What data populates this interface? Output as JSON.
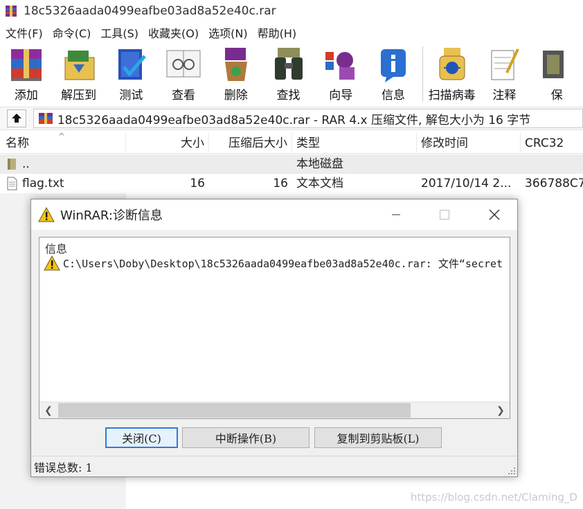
{
  "window": {
    "title": "18c5326aada0499eafbe03ad8a52e40c.rar"
  },
  "menu": [
    "文件(F)",
    "命令(C)",
    "工具(S)",
    "收藏夹(O)",
    "选项(N)",
    "帮助(H)"
  ],
  "toolbar": [
    {
      "label": "添加",
      "icon": "archive-books-icon"
    },
    {
      "label": "解压到",
      "icon": "extract-folder-icon"
    },
    {
      "label": "测试",
      "icon": "test-check-icon"
    },
    {
      "label": "查看",
      "icon": "view-glasses-icon"
    },
    {
      "label": "删除",
      "icon": "delete-recycle-icon"
    },
    {
      "label": "查找",
      "icon": "find-binoculars-icon"
    },
    {
      "label": "向导",
      "icon": "wizard-icon"
    },
    {
      "label": "信息",
      "icon": "info-icon"
    },
    {
      "label": "扫描病毒",
      "icon": "virus-scan-icon"
    },
    {
      "label": "注释",
      "icon": "comment-notepad-icon"
    },
    {
      "label": "保",
      "icon": "protect-icon"
    }
  ],
  "address": {
    "text": "18c5326aada0499eafbe03ad8a52e40c.rar - RAR 4.x 压缩文件, 解包大小为 16 字节"
  },
  "columns": {
    "name": "名称",
    "size": "大小",
    "packed": "压缩后大小",
    "type": "类型",
    "modified": "修改时间",
    "crc": "CRC32"
  },
  "sort_indicator": "^",
  "rows": [
    {
      "name": "..",
      "size": "",
      "packed": "",
      "type": "本地磁盘",
      "modified": "",
      "crc": ""
    },
    {
      "name": "flag.txt",
      "size": "16",
      "packed": "16",
      "type": "文本文档",
      "modified": "2017/10/14 2...",
      "crc": "366788C7"
    }
  ],
  "dialog": {
    "title": "WinRAR:诊断信息",
    "header": "信息",
    "message": "C:\\Users\\Doby\\Desktop\\18c5326aada0499eafbe03ad8a52e40c.rar: 文件“secret",
    "buttons": {
      "close": "关闭(C)",
      "abort": "中断操作(B)",
      "copy": "复制到剪贴板(L)"
    },
    "status": "错误总数: 1"
  },
  "watermark": "https://blog.csdn.net/Claming_D",
  "colors": {
    "accent": "#2f7bd6",
    "warning": "#f3c318"
  }
}
